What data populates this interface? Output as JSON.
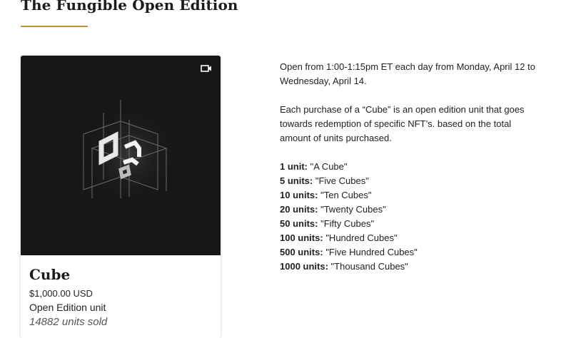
{
  "page": {
    "title": "The Fungible Open Edition",
    "accent_color": "#b8913f"
  },
  "card": {
    "media_icon": "video-camera-icon",
    "name": "Cube",
    "price": "$1,000.00 USD",
    "type": "Open Edition unit",
    "sold": "14882 units sold"
  },
  "description": {
    "schedule": "Open from 1:00-1:15pm ET each day from Monday, April 12 to Wednesday, April 14.",
    "details": "Each purchase of a “Cube” is an open edition unit that goes towards redemption of specific NFT’s. based on the total amount of units purchased.",
    "tiers": [
      {
        "qty": "1 unit:",
        "name": "\"A Cube\""
      },
      {
        "qty": "5 units:",
        "name": "\"Five Cubes\""
      },
      {
        "qty": "10 units:",
        "name": "\"Ten Cubes\""
      },
      {
        "qty": "20 units:",
        "name": "\"Twenty Cubes\""
      },
      {
        "qty": "50 units:",
        "name": "\"Fifty Cubes\""
      },
      {
        "qty": "100 units:",
        "name": "\"Hundred Cubes\""
      },
      {
        "qty": "500 units:",
        "name": "\"Five Hundred Cubes\""
      },
      {
        "qty": "1000 units:",
        "name": "\"Thousand Cubes\""
      }
    ]
  }
}
